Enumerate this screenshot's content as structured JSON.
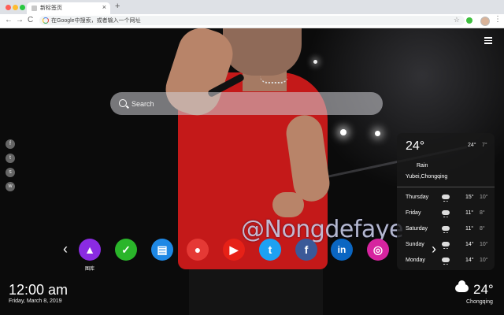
{
  "browser": {
    "tab_title": "新标签页",
    "tab_close": "×",
    "new_tab": "+",
    "address": "在Google中搜索，或者输入一个网址",
    "back": "←",
    "forward": "→",
    "reload": "C",
    "star": "☆",
    "menu": "⋮"
  },
  "search": {
    "placeholder": "Search"
  },
  "watermark": "@Nongdefaye",
  "side_social": [
    {
      "icon": "facebook-icon",
      "glyph": "f"
    },
    {
      "icon": "twitter-icon",
      "glyph": "t"
    },
    {
      "icon": "snapchat-icon",
      "glyph": "s"
    },
    {
      "icon": "wechat-icon",
      "glyph": "w"
    }
  ],
  "weather": {
    "temp": "24°",
    "high": "24°",
    "low": "7°",
    "condition": "Rain",
    "location": "Yubei,Chongqing",
    "forecast": [
      {
        "day": "Thursday",
        "high": "15°",
        "low": "10°"
      },
      {
        "day": "Friday",
        "high": "11°",
        "low": "8°"
      },
      {
        "day": "Saturday",
        "high": "11°",
        "low": "8°"
      },
      {
        "day": "Sunday",
        "high": "14°",
        "low": "10°"
      },
      {
        "day": "Monday",
        "high": "14°",
        "low": "10°"
      }
    ]
  },
  "dock": {
    "prev": "‹",
    "next": "›",
    "apps": [
      {
        "name": "gallery",
        "label": "图库",
        "color": "#8a2be2",
        "glyph": "▲"
      },
      {
        "name": "tasks",
        "label": "",
        "color": "#2ab52a",
        "glyph": "✓"
      },
      {
        "name": "notes",
        "label": "",
        "color": "#1e88e5",
        "glyph": "▤"
      },
      {
        "name": "games",
        "label": "",
        "color": "#e53935",
        "glyph": "●"
      },
      {
        "name": "youtube",
        "label": "",
        "color": "#e62117",
        "glyph": "▶"
      },
      {
        "name": "twitter",
        "label": "",
        "color": "#1da1f2",
        "glyph": "t"
      },
      {
        "name": "facebook",
        "label": "",
        "color": "#3b5998",
        "glyph": "f"
      },
      {
        "name": "linkedin",
        "label": "",
        "color": "#0a66c2",
        "glyph": "in"
      },
      {
        "name": "instagram",
        "label": "",
        "color": "#d6249f",
        "glyph": "◎"
      }
    ]
  },
  "clock": {
    "time": "12:00 am",
    "date": "Friday, March 8, 2019"
  },
  "bottom_weather": {
    "temp": "24°",
    "location": "Chongqing"
  },
  "colors": {
    "tab_strip": "#dee1e6",
    "weather_panel": "#191919"
  }
}
